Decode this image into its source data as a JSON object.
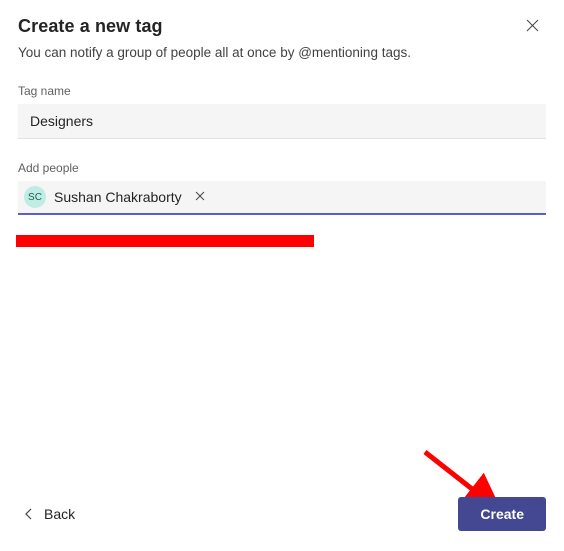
{
  "header": {
    "title": "Create a new tag",
    "subtitle": "You can notify a group of people all at once by @mentioning tags."
  },
  "fields": {
    "tag_name_label": "Tag name",
    "tag_name_value": "Designers",
    "add_people_label": "Add people"
  },
  "people_chip": {
    "initials": "SC",
    "name": "Sushan Chakraborty"
  },
  "footer": {
    "back_label": "Back",
    "create_label": "Create"
  },
  "annotations": {
    "redaction_color": "#ff0000",
    "arrow_color": "#ff0000"
  }
}
